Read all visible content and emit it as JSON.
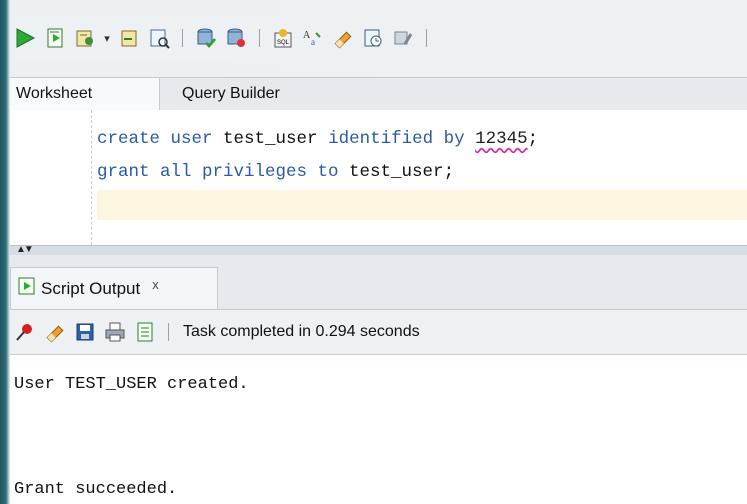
{
  "toolbar": {
    "buttons": [
      "run-statement-icon",
      "run-script-icon",
      "commit-icon",
      "rollback-icon",
      "explain-plan-icon",
      "autotrace-icon",
      "sql-tuning-icon",
      "format-icon",
      "clear-icon",
      "history-icon",
      "tools-icon"
    ],
    "dropdown_caret": "▾"
  },
  "tabs": {
    "worksheet": "Worksheet",
    "query_builder": "Query Builder"
  },
  "editor": {
    "line1": {
      "kw1": "create user",
      "plain1": " test_user ",
      "kw2": "identified by",
      "plain2": " ",
      "num": "12345",
      "end": ";"
    },
    "line2": {
      "kw1": "grant all privileges to",
      "plain1": " test_user;"
    }
  },
  "splitter": {
    "arrows": "▲▼"
  },
  "output_panel": {
    "tab_label": "Script Output",
    "tab_close": "x",
    "status": "Task completed in 0.294 seconds",
    "lines": [
      "User TEST_USER created.",
      "",
      "",
      "Grant succeeded."
    ]
  },
  "colors": {
    "keyword": "#2b5aa8",
    "current_line": "#fcf5df",
    "run_green": "#2e9d2e",
    "frame": "#1f5560"
  }
}
